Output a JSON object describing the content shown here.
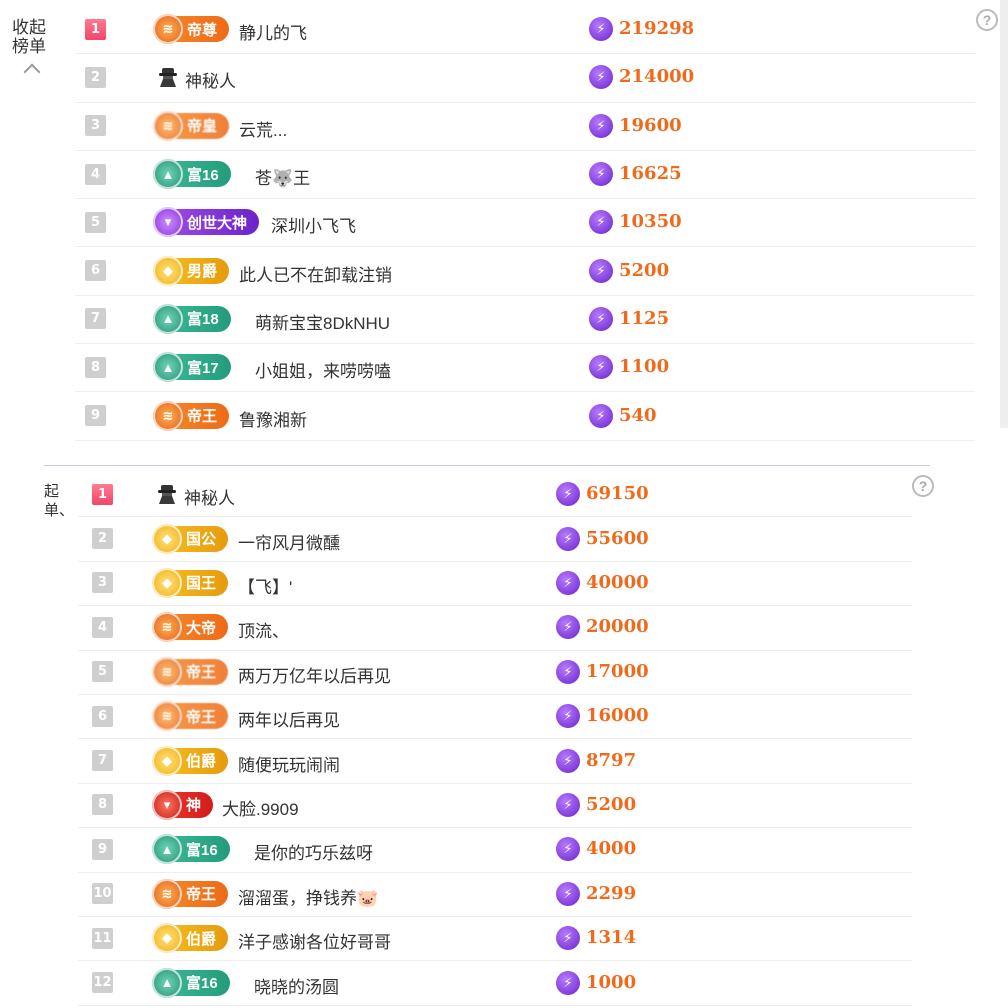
{
  "top_panel": {
    "toggle_label": "收起榜单",
    "help": "?",
    "rows": [
      {
        "rank": "1",
        "badge": "帝尊",
        "badge_style": "orange",
        "name": "静儿的飞",
        "score": "219298"
      },
      {
        "rank": "2",
        "badge": "",
        "badge_style": "spy",
        "name": "神秘人",
        "score": "214000"
      },
      {
        "rank": "3",
        "badge": "帝皇",
        "badge_style": "orange-blur",
        "name": "云荒...",
        "score": "19600"
      },
      {
        "rank": "4",
        "badge": "富16",
        "badge_style": "green",
        "name": "苍🐺王",
        "score": "16625"
      },
      {
        "rank": "5",
        "badge": "创世大神",
        "badge_style": "purple",
        "name": "深圳小飞飞",
        "score": "10350"
      },
      {
        "rank": "6",
        "badge": "男爵",
        "badge_style": "gold",
        "name": "此人已不在卸载注销",
        "score": "5200"
      },
      {
        "rank": "7",
        "badge": "富18",
        "badge_style": "green",
        "name": "萌新宝宝8DkNHU",
        "score": "1125"
      },
      {
        "rank": "8",
        "badge": "富17",
        "badge_style": "green",
        "name": "小姐姐，来唠唠嗑",
        "score": "1100"
      },
      {
        "rank": "9",
        "badge": "帝王",
        "badge_style": "orange",
        "name": "鲁豫湘新",
        "score": "540"
      }
    ]
  },
  "bottom_panel": {
    "toggle_label": "起单、",
    "help": "?",
    "rows": [
      {
        "rank": "1",
        "badge": "",
        "badge_style": "spy",
        "name": "神秘人",
        "score": "69150"
      },
      {
        "rank": "2",
        "badge": "国公",
        "badge_style": "gold",
        "name": "一帘风月微醺",
        "score": "55600"
      },
      {
        "rank": "3",
        "badge": "国王",
        "badge_style": "gold",
        "name": "【飞】'",
        "score": "40000"
      },
      {
        "rank": "4",
        "badge": "大帝",
        "badge_style": "orange",
        "name": "顶流、",
        "score": "20000"
      },
      {
        "rank": "5",
        "badge": "帝王",
        "badge_style": "orange-blur",
        "name": "两万万亿年以后再见",
        "score": "17000"
      },
      {
        "rank": "6",
        "badge": "帝王",
        "badge_style": "orange-blur",
        "name": "两年以后再见",
        "score": "16000"
      },
      {
        "rank": "7",
        "badge": "伯爵",
        "badge_style": "gold",
        "name": "随便玩玩闹闹",
        "score": "8797"
      },
      {
        "rank": "8",
        "badge": "神",
        "badge_style": "red",
        "name": "大脸.9909",
        "score": "5200"
      },
      {
        "rank": "9",
        "badge": "富16",
        "badge_style": "green",
        "name": "是你的巧乐兹呀",
        "score": "4000"
      },
      {
        "rank": "10",
        "badge": "帝王",
        "badge_style": "orange",
        "name": "溜溜蛋，挣钱养🐷",
        "score": "2299"
      },
      {
        "rank": "11",
        "badge": "伯爵",
        "badge_style": "gold",
        "name": "洋子感谢各位好哥哥",
        "score": "1314"
      },
      {
        "rank": "12",
        "badge": "富16",
        "badge_style": "green",
        "name": "晓晓的汤圆",
        "score": "1000"
      }
    ]
  }
}
